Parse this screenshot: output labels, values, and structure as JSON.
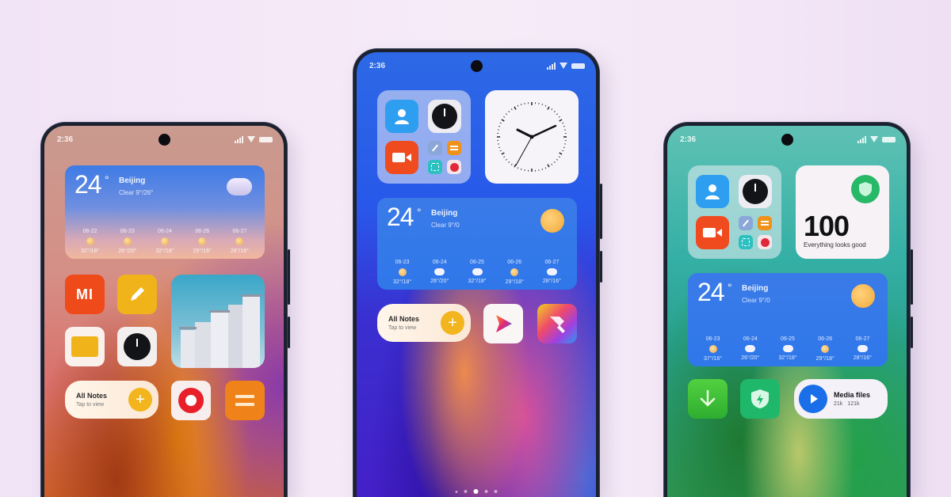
{
  "phones": [
    {
      "id": "left",
      "status": {
        "time": "2:36"
      },
      "weather": {
        "temp": "24",
        "degree": "°",
        "city": "Beijing",
        "desc": "Clear 9°/26°",
        "forecast": [
          {
            "date": "06-22",
            "icon": "sun-icon",
            "range": "32°/18°"
          },
          {
            "date": "06-23",
            "icon": "sun-icon",
            "range": "26°/20°"
          },
          {
            "date": "06-24",
            "icon": "sun-icon",
            "range": "32°/18°"
          },
          {
            "date": "06-26",
            "icon": "sun-icon",
            "range": "29°/16°"
          },
          {
            "date": "06-27",
            "icon": "sun-icon",
            "range": "28°/16°"
          }
        ]
      },
      "apps": [
        {
          "name": "mi-app",
          "label": "MI",
          "color": "#ee4a1a"
        },
        {
          "name": "notes-pencil-app",
          "color": "#f0b31a"
        },
        {
          "name": "file-manager-app",
          "color": "#fbf1ec"
        },
        {
          "name": "clock-app",
          "color": "#f3efef"
        },
        {
          "name": "screen-recorder-app",
          "color": "#f8eeee"
        },
        {
          "name": "calculator-app",
          "color": "#f0821a"
        }
      ],
      "notes_widget": {
        "title": "All Notes",
        "subtitle": "Tap to view",
        "plus": "+"
      }
    },
    {
      "id": "middle",
      "status": {
        "time": "2:36"
      },
      "weather": {
        "temp": "24",
        "degree": "°",
        "city": "Beijing",
        "desc": "Clear 9°/0",
        "forecast": [
          {
            "date": "06-23",
            "icon": "sun-icon",
            "range": "32°/18°"
          },
          {
            "date": "06-24",
            "icon": "cloud-icon",
            "range": "26°/20°"
          },
          {
            "date": "06-25",
            "icon": "cloud-icon",
            "range": "32°/18°"
          },
          {
            "date": "06-26",
            "icon": "sun-icon",
            "range": "29°/18°"
          },
          {
            "date": "06-27",
            "icon": "cloud-icon",
            "range": "28°/16°"
          }
        ]
      },
      "folder_apps": [
        {
          "name": "contacts-app",
          "color": "#2d9ef0"
        },
        {
          "name": "clock-app",
          "color": "#ececf2"
        },
        {
          "name": "video-call-app",
          "color": "#f04b1e"
        },
        {
          "name": "notes-app",
          "color": "#8aa7d8"
        },
        {
          "name": "calculator-app",
          "color": "#f0921a"
        },
        {
          "name": "scanner-app",
          "color": "#2cc0c0"
        },
        {
          "name": "security-app",
          "color": "#f6e6ea"
        }
      ],
      "clock_widget": {
        "label": "analog-clock"
      },
      "notes_widget": {
        "title": "All Notes",
        "subtitle": "Tap to view",
        "plus": "+"
      },
      "dock_apps": [
        {
          "name": "video-player-app"
        },
        {
          "name": "themes-app"
        }
      ],
      "page_indicator": {
        "count": 5,
        "active": 3
      }
    },
    {
      "id": "right",
      "status": {
        "time": "2:36"
      },
      "folder_apps": [
        {
          "name": "contacts-app",
          "color": "#2d9ef0"
        },
        {
          "name": "clock-app",
          "color": "#ececf2"
        },
        {
          "name": "video-call-app",
          "color": "#f04b1e"
        },
        {
          "name": "notes-app",
          "color": "#8aa7d8"
        },
        {
          "name": "calculator-app",
          "color": "#f0921a"
        },
        {
          "name": "scanner-app",
          "color": "#2cc0c0"
        },
        {
          "name": "security-app",
          "color": "#f6e6ea"
        }
      ],
      "security_widget": {
        "score": "100",
        "message": "Everything looks good"
      },
      "weather": {
        "temp": "24",
        "degree": "°",
        "city": "Beijing",
        "desc": "Clear 9°/0",
        "forecast": [
          {
            "date": "06-23",
            "icon": "sun-icon",
            "range": "37°/16°"
          },
          {
            "date": "06-24",
            "icon": "cloud-icon",
            "range": "26°/20°"
          },
          {
            "date": "06-25",
            "icon": "cloud-icon",
            "range": "32°/18°"
          },
          {
            "date": "06-26",
            "icon": "sun-icon",
            "range": "29°/18°"
          },
          {
            "date": "06-27",
            "icon": "cloud-icon",
            "range": "28°/16°"
          }
        ]
      },
      "dock_apps": [
        {
          "name": "downloads-app",
          "color": "#3cc23c"
        },
        {
          "name": "security-app",
          "color": "#1fb86a"
        }
      ],
      "media_widget": {
        "title": "Media files",
        "stat1": "21k",
        "stat2": "121k"
      }
    }
  ]
}
